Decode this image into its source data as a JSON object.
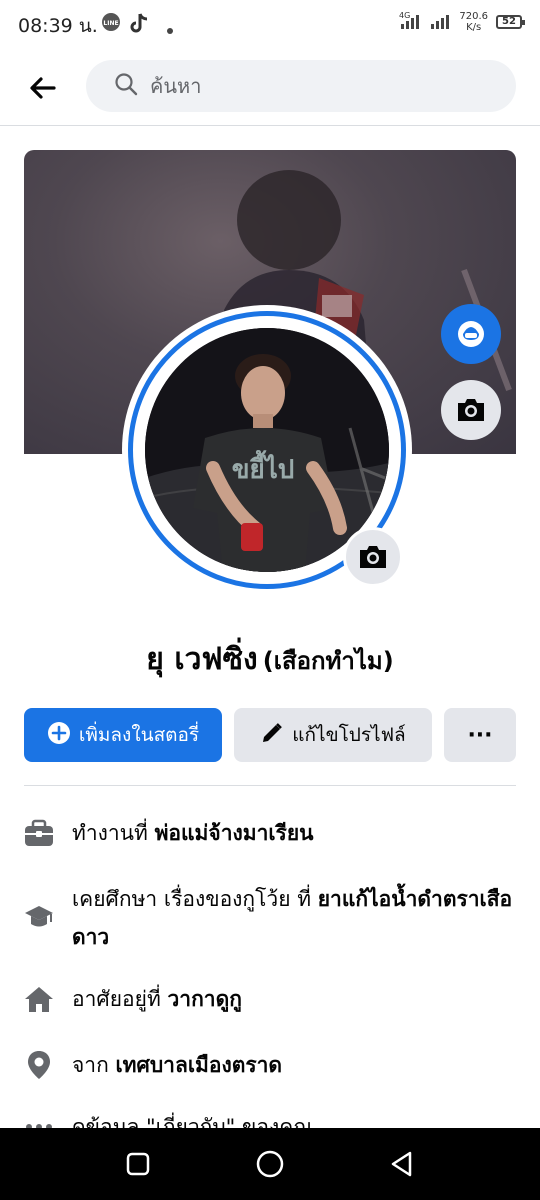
{
  "status_bar": {
    "time": "08:39 น.",
    "network_speed": "720.6",
    "network_speed_unit": "K/s",
    "battery": "52",
    "signal_label": "4G"
  },
  "search": {
    "placeholder": "ค้นหา"
  },
  "profile": {
    "name": "ยุ เวฟซิ่ง",
    "alt_name": "(เสือกทำไม)"
  },
  "actions": {
    "add_story": "เพิ่มลงในสตอรี่",
    "edit_profile": "แก้ไขโปรไฟล์",
    "more": "···"
  },
  "details": {
    "work": {
      "prefix": "ทำงานที่ ",
      "value": "พ่อแม่จ้างมาเรียน"
    },
    "education": {
      "prefix": "เคยศึกษา เรื่องของกูโว้ย ที่ ",
      "value": "ยาแก้ไอน้ำดำตราเสือดาว"
    },
    "lives": {
      "prefix": "อาศัยอยู่ที่ ",
      "value": "วากาดูกู"
    },
    "from": {
      "prefix": "จาก ",
      "value": "เทศบาลเมืองตราด"
    },
    "more": {
      "text": "ดูข้อมูล \"เกี่ยวกับ\" ของคุณ"
    }
  },
  "colors": {
    "accent": "#1b74e4",
    "button_gray": "#e4e6eb",
    "icon_gray": "#65676b"
  }
}
